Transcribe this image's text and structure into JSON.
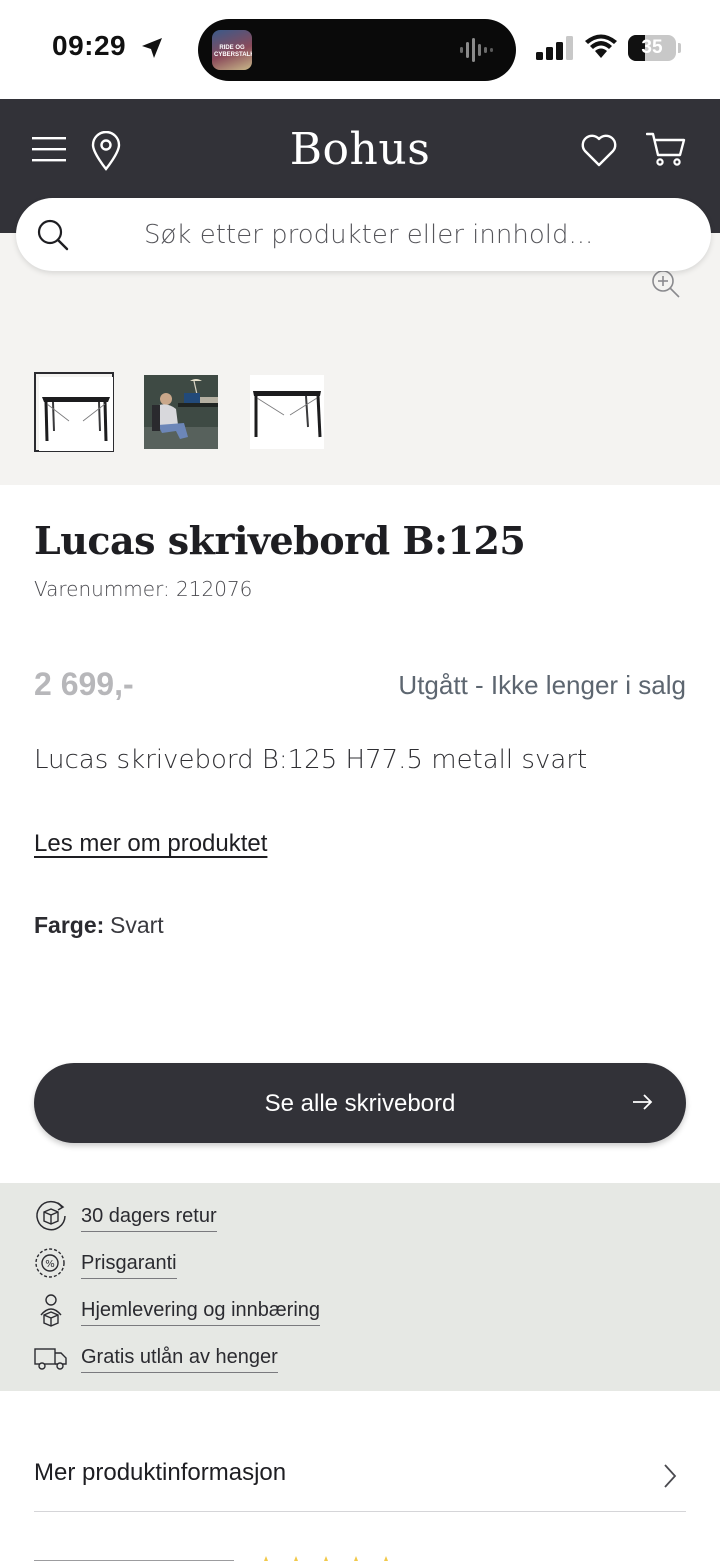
{
  "status_bar": {
    "time": "09:29",
    "battery": "35",
    "battery_level": 0.35,
    "now_playing_art_text": "RIDE OG CYBERSTALKERE"
  },
  "header": {
    "logo": "Bohus",
    "icons": [
      "menu-icon",
      "location-pin-icon",
      "heart-icon",
      "cart-icon"
    ]
  },
  "search": {
    "placeholder": "Søk etter produkter eller innhold..."
  },
  "gallery": {
    "thumbnails": [
      "desk-front",
      "desk-in-room-with-person",
      "desk-front-alt"
    ],
    "selected_index": 0
  },
  "product": {
    "title": "Lucas skrivebord B:125",
    "sku": "Varenummer: 212076",
    "price": "2 699,-",
    "availability": "Utgått - Ikke lenger i salg",
    "description": "Lucas skrivebord B:125 H77.5 metall svart",
    "read_more": "Les mer om produktet",
    "color_label": "Farge:",
    "color_value": "Svart"
  },
  "cta": {
    "label": "Se alle skrivebord"
  },
  "usps": [
    {
      "label": "30 dagers retur",
      "icon": "return-box-icon"
    },
    {
      "label": "Prisgaranti",
      "icon": "price-guarantee-icon"
    },
    {
      "label": "Hjemlevering og innbæring",
      "icon": "person-carry-box-icon"
    },
    {
      "label": "Gratis utlån av henger",
      "icon": "trailer-truck-icon"
    }
  ],
  "accordion": {
    "more_info": "Mer produktinformasjon"
  },
  "colors": {
    "header_bg": "#323238",
    "gallery_bg": "#f4f3f1",
    "usp_bg": "#e6e8e4",
    "price_muted": "#b7b7ba",
    "status_text": "#5d6670",
    "rating_star": "#f2c94c"
  }
}
